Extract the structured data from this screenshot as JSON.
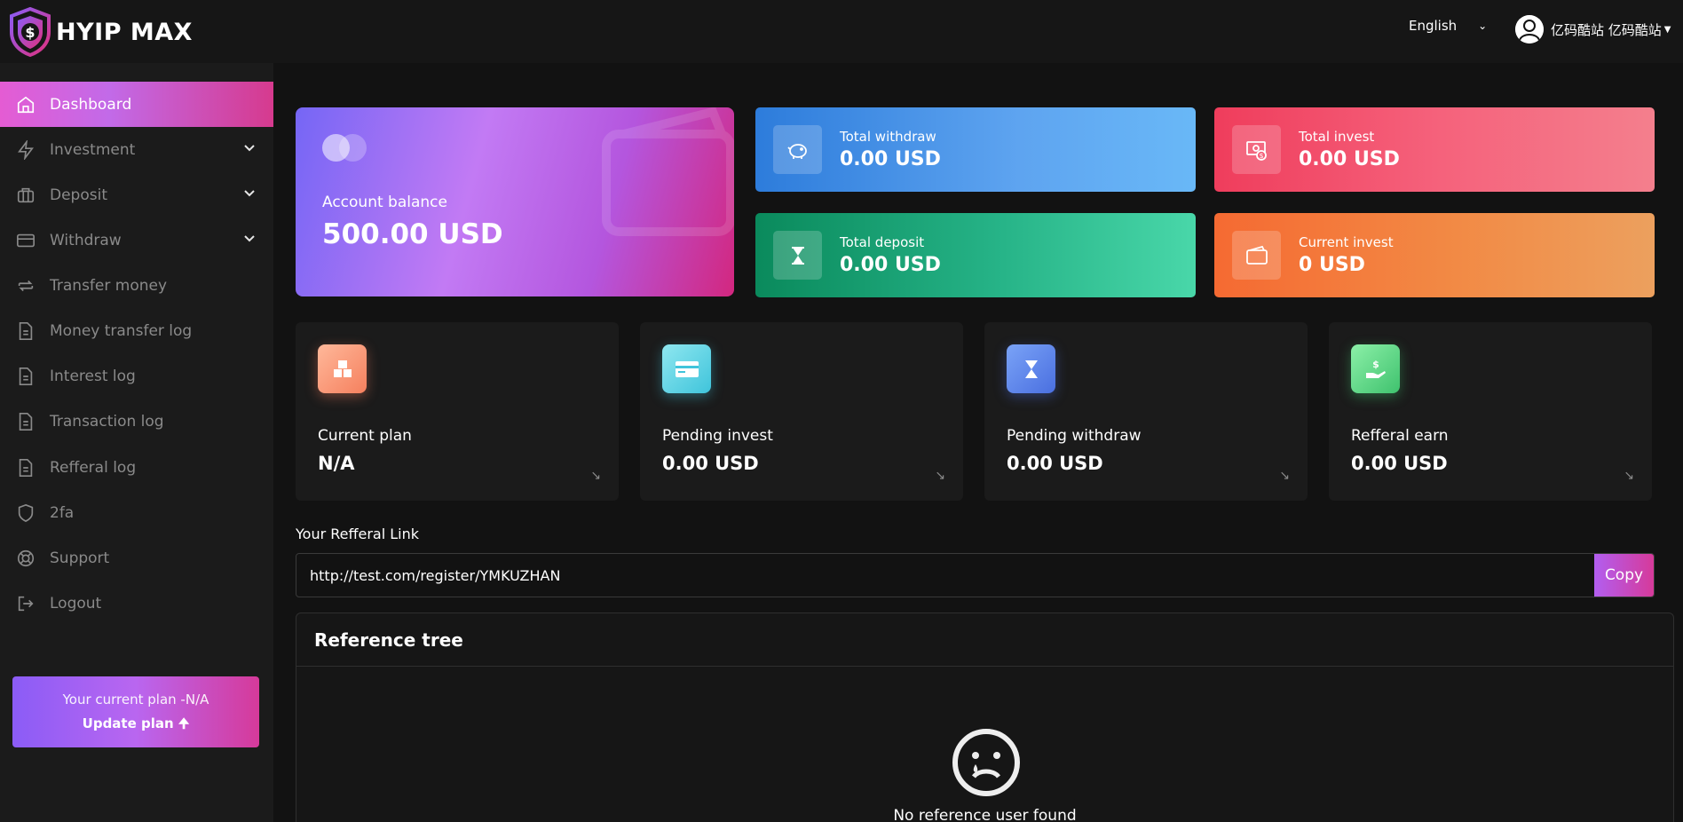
{
  "brand": {
    "name": "HYIP MAX"
  },
  "topbar": {
    "language": "English",
    "user_name": "亿码酷站 亿码酷站"
  },
  "sidebar": {
    "items": [
      {
        "label": "Dashboard",
        "icon": "home-icon"
      },
      {
        "label": "Investment",
        "icon": "bolt-icon"
      },
      {
        "label": "Deposit",
        "icon": "briefcase-icon"
      },
      {
        "label": "Withdraw",
        "icon": "credit-card-icon"
      },
      {
        "label": "Transfer money",
        "icon": "transfer-icon"
      },
      {
        "label": "Money transfer log",
        "icon": "document-icon"
      },
      {
        "label": "Interest log",
        "icon": "document-icon"
      },
      {
        "label": "Transaction log",
        "icon": "document-icon"
      },
      {
        "label": "Refferal log",
        "icon": "document-icon"
      },
      {
        "label": "2fa",
        "icon": "shield-icon"
      },
      {
        "label": "Support",
        "icon": "lifebuoy-icon"
      },
      {
        "label": "Logout",
        "icon": "logout-icon"
      }
    ],
    "plan_box": {
      "text": "Your current plan -N/A",
      "update_label": "Update plan"
    }
  },
  "balance": {
    "label": "Account balance",
    "value": "500.00 USD"
  },
  "stats": {
    "total_withdraw": {
      "label": "Total withdraw",
      "value": "0.00 USD"
    },
    "total_invest": {
      "label": "Total invest",
      "value": "0.00 USD"
    },
    "total_deposit": {
      "label": "Total deposit",
      "value": "0.00 USD"
    },
    "current_invest": {
      "label": "Current invest",
      "value": "0 USD"
    }
  },
  "mini_cards": {
    "current_plan": {
      "label": "Current plan",
      "value": "N/A"
    },
    "pending_invest": {
      "label": "Pending invest",
      "value": "0.00 USD"
    },
    "pending_withdraw": {
      "label": "Pending withdraw",
      "value": "0.00 USD"
    },
    "refferal_earn": {
      "label": "Refferal earn",
      "value": "0.00 USD"
    }
  },
  "referral": {
    "label": "Your Refferal Link",
    "link": "http://test.com/register/YMKUZHAN",
    "copy_label": "Copy"
  },
  "reference_tree": {
    "title": "Reference tree",
    "empty_text": "No reference user found"
  },
  "colors": {
    "accent_pink": "#d63a9a",
    "accent_purple": "#8b5cf6",
    "bg": "#121212",
    "sidebar_bg": "#1b1b1b"
  }
}
